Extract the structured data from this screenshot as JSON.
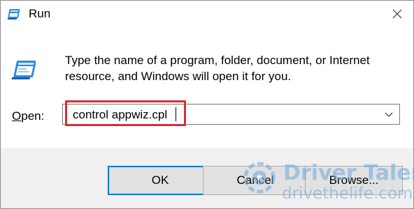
{
  "window": {
    "title": "Run",
    "close_glyph": "✕"
  },
  "dialog": {
    "description": "Type the name of a program, folder, document, or Internet resource, and Windows will open it for you.",
    "open_label_prefix": "",
    "open_label_underlined": "O",
    "open_label_rest": "pen:",
    "command_value": "control appwiz.cpl"
  },
  "buttons": {
    "ok": "OK",
    "cancel": "Cancel",
    "browse": "Browse..."
  },
  "watermark": {
    "brand": "Driver Talent",
    "url": "drivethelife.com"
  },
  "colors": {
    "highlight_border": "#d0313b",
    "footer_bg": "#f0f0f0",
    "ok_border": "#0078d7",
    "watermark": "#6aa8de"
  },
  "icons": [
    "run-app-icon",
    "run-dialog-icon",
    "close-icon",
    "chevron-down-icon",
    "driver-talent-logo-icon"
  ]
}
